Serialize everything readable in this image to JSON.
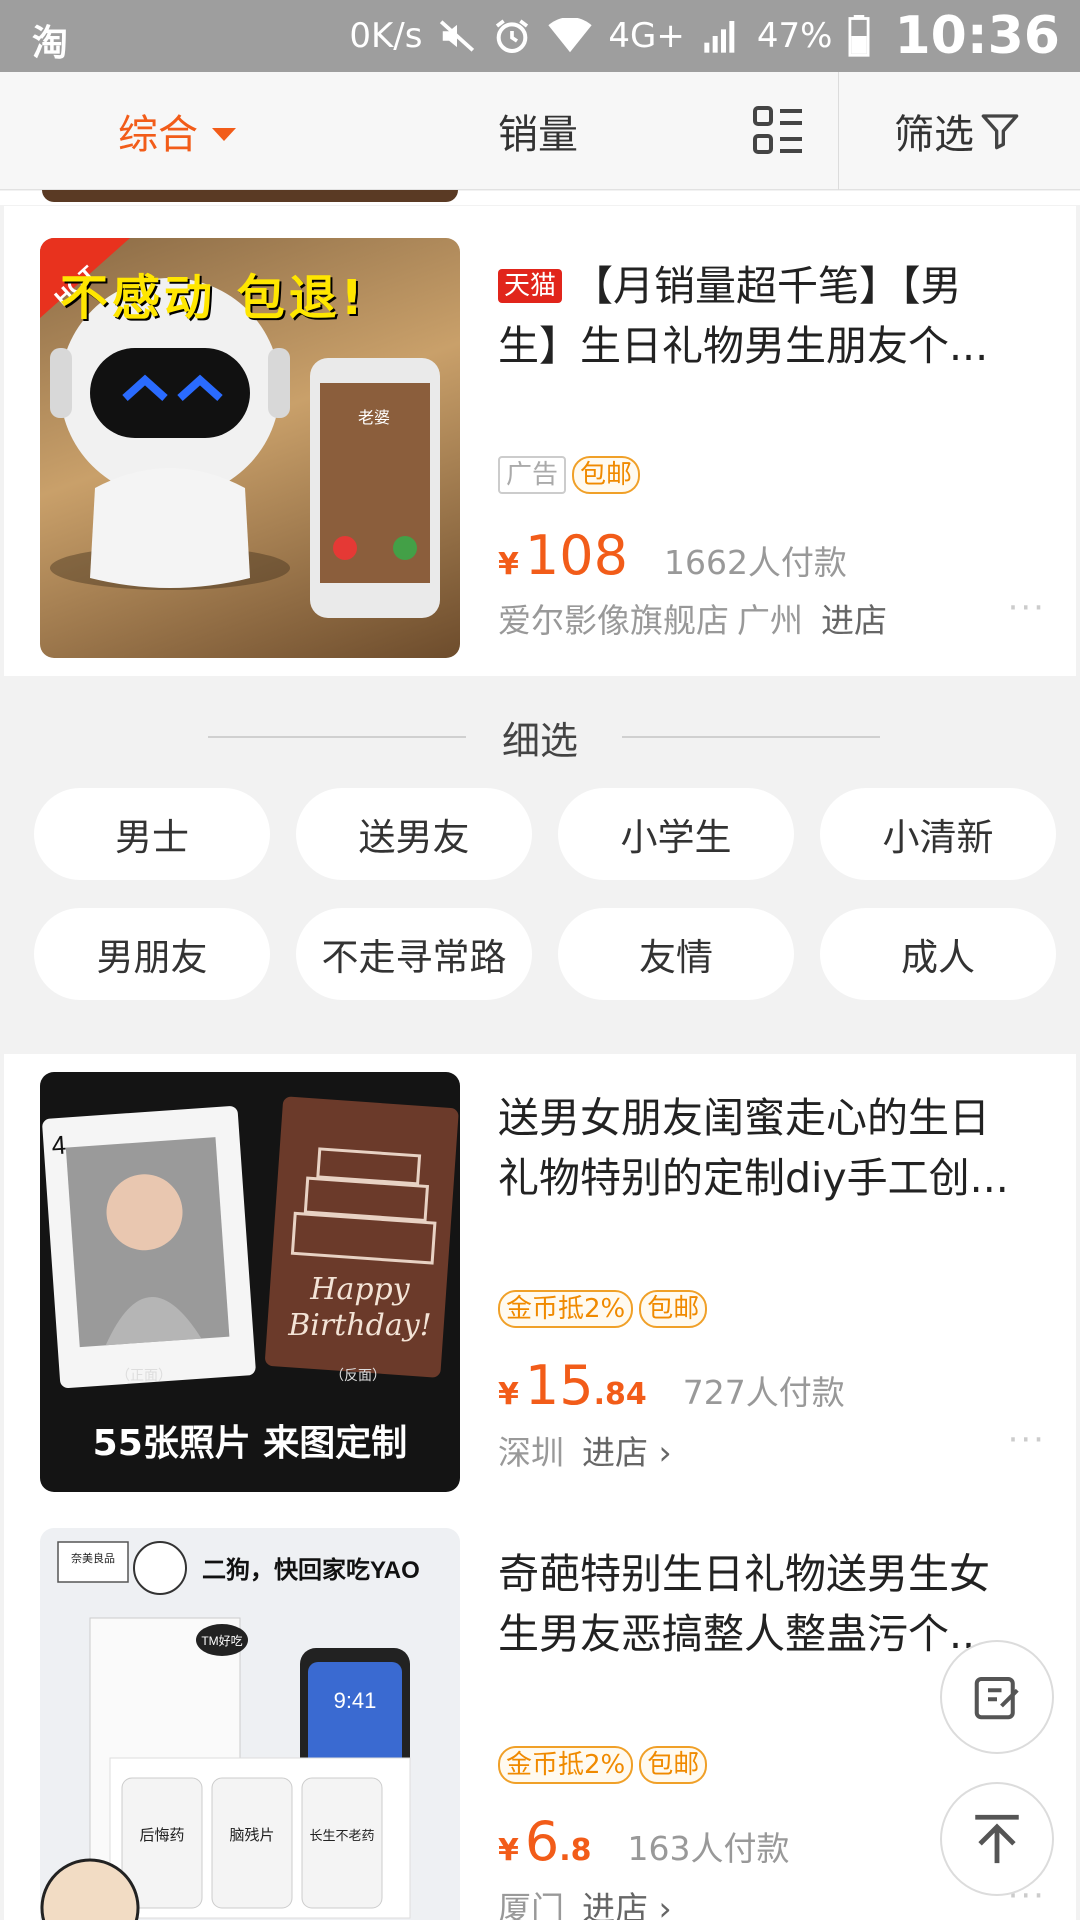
{
  "status_bar": {
    "app_icon": "淘",
    "net_speed": "0K/s",
    "network": "4G+",
    "battery": "47%",
    "time": "10:36",
    "icons": [
      "mute-icon",
      "alarm-icon",
      "wifi-icon",
      "signal-icon",
      "battery-icon"
    ]
  },
  "sort_bar": {
    "comprehensive": "综合",
    "sales": "销量",
    "filter": "筛选",
    "active_color": "#f25c19"
  },
  "products": [
    {
      "tmall_tag": "天猫",
      "title": "【月销量超千笔】【男生】生日礼物男生朋友个...",
      "badges": [
        "广告",
        "包邮"
      ],
      "price_yen": "¥",
      "price_int": "108",
      "price_dec": "",
      "paid": "1662人付款",
      "shop": "爱尔影像旗舰店",
      "city": "广州",
      "enter": "进店",
      "more": "···",
      "image": {
        "hot": "HOT",
        "headline": "不感动 包退!",
        "phone_caller": "老婆"
      }
    },
    {
      "title": "送男女朋友闺蜜走心的生日礼物特别的定制diy手工创...",
      "badges": [
        "金币抵2%",
        "包邮"
      ],
      "price_yen": "¥",
      "price_int": "15",
      "price_dec": ".84",
      "paid": "727人付款",
      "city": "深圳",
      "enter": "进店 ›",
      "more": "···",
      "image": {
        "card_rank": "4",
        "front_label": "（正面）",
        "back_label": "（反面）",
        "birthday_text": "Happy Birthday!",
        "caption": "55张照片 来图定制"
      }
    },
    {
      "title": "奇葩特别生日礼物送男生女生男友恶搞整人整蛊污个...",
      "badges": [
        "金币抵2%",
        "包邮"
      ],
      "price_yen": "¥",
      "price_int": "6",
      "price_dec": ".8",
      "paid": "163人付款",
      "city": "厦门",
      "enter": "进店 ›",
      "more": "···",
      "image": {
        "brand": "奈美良品",
        "bubble": "二狗，快回家吃YAO",
        "sticker": "TM好吃",
        "phone_time": "9:41",
        "bottle1": "后悔药",
        "bottle2": "脑残片",
        "bottle3": "长生不老药"
      }
    }
  ],
  "refine": {
    "title": "细选",
    "chips": [
      "男士",
      "送男友",
      "小学生",
      "小清新",
      "男朋友",
      "不走寻常路",
      "友情",
      "成人"
    ]
  },
  "fab": {
    "edit_icon": "edit-icon",
    "top_icon": "back-to-top-icon"
  }
}
